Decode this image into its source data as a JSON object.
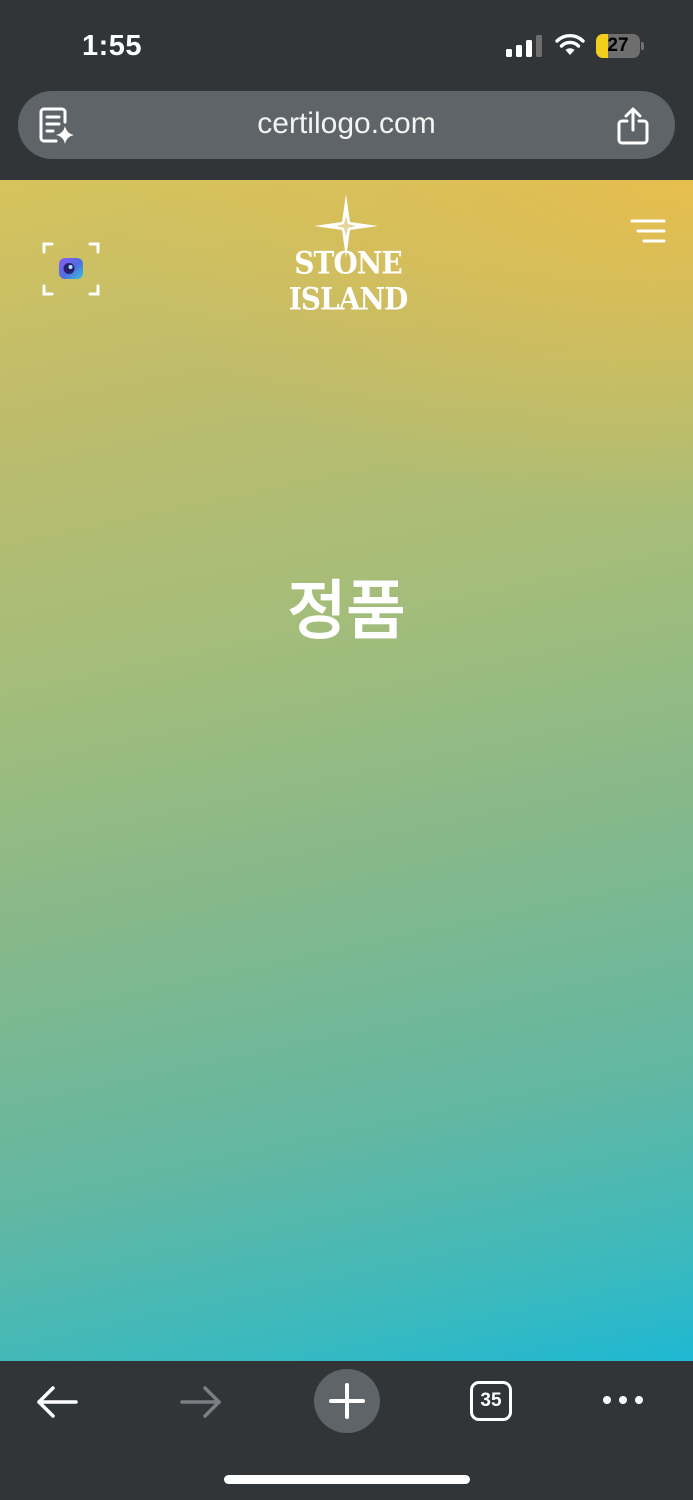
{
  "status_bar": {
    "time": "1:55",
    "battery_level": "27",
    "battery_fraction": 0.27,
    "battery_color": "#f2cf1d",
    "signal_bars": 3,
    "signal_bars_total": 4
  },
  "browser": {
    "url": "certilogo.com",
    "reader_icon": "page-sparkle-icon",
    "share_icon": "share-icon"
  },
  "page": {
    "brand_logo_text": "STONE ISLAND",
    "status_heading": "정품",
    "scan_icon": "scan-camera-icon",
    "menu_icon": "hamburger-menu-icon"
  },
  "toolbar": {
    "back_icon": "arrow-left-icon",
    "forward_icon": "arrow-right-icon",
    "new_tab_icon": "plus-icon",
    "tab_count": "35",
    "more_icon": "ellipsis-icon"
  }
}
